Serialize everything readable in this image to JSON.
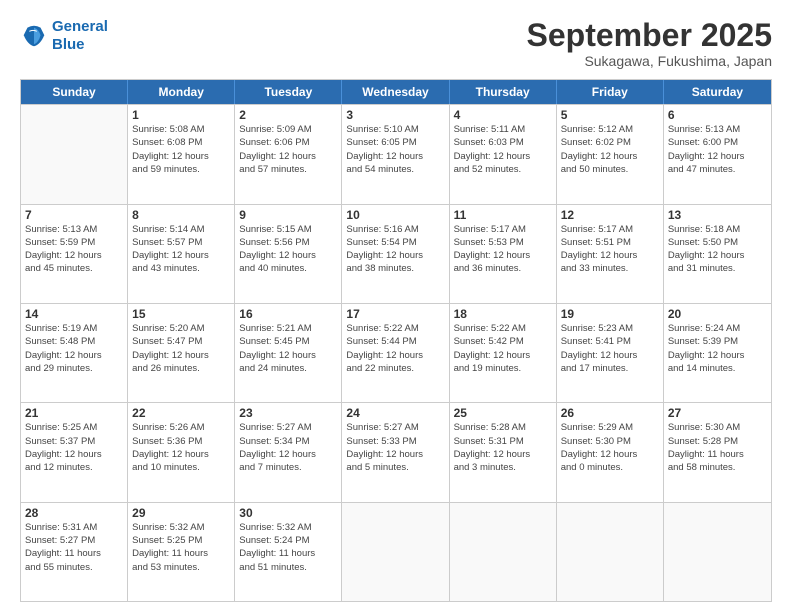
{
  "logo": {
    "line1": "General",
    "line2": "Blue"
  },
  "title": "September 2025",
  "subtitle": "Sukagawa, Fukushima, Japan",
  "header_days": [
    "Sunday",
    "Monday",
    "Tuesday",
    "Wednesday",
    "Thursday",
    "Friday",
    "Saturday"
  ],
  "weeks": [
    [
      {
        "day": "",
        "info": ""
      },
      {
        "day": "1",
        "info": "Sunrise: 5:08 AM\nSunset: 6:08 PM\nDaylight: 12 hours\nand 59 minutes."
      },
      {
        "day": "2",
        "info": "Sunrise: 5:09 AM\nSunset: 6:06 PM\nDaylight: 12 hours\nand 57 minutes."
      },
      {
        "day": "3",
        "info": "Sunrise: 5:10 AM\nSunset: 6:05 PM\nDaylight: 12 hours\nand 54 minutes."
      },
      {
        "day": "4",
        "info": "Sunrise: 5:11 AM\nSunset: 6:03 PM\nDaylight: 12 hours\nand 52 minutes."
      },
      {
        "day": "5",
        "info": "Sunrise: 5:12 AM\nSunset: 6:02 PM\nDaylight: 12 hours\nand 50 minutes."
      },
      {
        "day": "6",
        "info": "Sunrise: 5:13 AM\nSunset: 6:00 PM\nDaylight: 12 hours\nand 47 minutes."
      }
    ],
    [
      {
        "day": "7",
        "info": "Sunrise: 5:13 AM\nSunset: 5:59 PM\nDaylight: 12 hours\nand 45 minutes."
      },
      {
        "day": "8",
        "info": "Sunrise: 5:14 AM\nSunset: 5:57 PM\nDaylight: 12 hours\nand 43 minutes."
      },
      {
        "day": "9",
        "info": "Sunrise: 5:15 AM\nSunset: 5:56 PM\nDaylight: 12 hours\nand 40 minutes."
      },
      {
        "day": "10",
        "info": "Sunrise: 5:16 AM\nSunset: 5:54 PM\nDaylight: 12 hours\nand 38 minutes."
      },
      {
        "day": "11",
        "info": "Sunrise: 5:17 AM\nSunset: 5:53 PM\nDaylight: 12 hours\nand 36 minutes."
      },
      {
        "day": "12",
        "info": "Sunrise: 5:17 AM\nSunset: 5:51 PM\nDaylight: 12 hours\nand 33 minutes."
      },
      {
        "day": "13",
        "info": "Sunrise: 5:18 AM\nSunset: 5:50 PM\nDaylight: 12 hours\nand 31 minutes."
      }
    ],
    [
      {
        "day": "14",
        "info": "Sunrise: 5:19 AM\nSunset: 5:48 PM\nDaylight: 12 hours\nand 29 minutes."
      },
      {
        "day": "15",
        "info": "Sunrise: 5:20 AM\nSunset: 5:47 PM\nDaylight: 12 hours\nand 26 minutes."
      },
      {
        "day": "16",
        "info": "Sunrise: 5:21 AM\nSunset: 5:45 PM\nDaylight: 12 hours\nand 24 minutes."
      },
      {
        "day": "17",
        "info": "Sunrise: 5:22 AM\nSunset: 5:44 PM\nDaylight: 12 hours\nand 22 minutes."
      },
      {
        "day": "18",
        "info": "Sunrise: 5:22 AM\nSunset: 5:42 PM\nDaylight: 12 hours\nand 19 minutes."
      },
      {
        "day": "19",
        "info": "Sunrise: 5:23 AM\nSunset: 5:41 PM\nDaylight: 12 hours\nand 17 minutes."
      },
      {
        "day": "20",
        "info": "Sunrise: 5:24 AM\nSunset: 5:39 PM\nDaylight: 12 hours\nand 14 minutes."
      }
    ],
    [
      {
        "day": "21",
        "info": "Sunrise: 5:25 AM\nSunset: 5:37 PM\nDaylight: 12 hours\nand 12 minutes."
      },
      {
        "day": "22",
        "info": "Sunrise: 5:26 AM\nSunset: 5:36 PM\nDaylight: 12 hours\nand 10 minutes."
      },
      {
        "day": "23",
        "info": "Sunrise: 5:27 AM\nSunset: 5:34 PM\nDaylight: 12 hours\nand 7 minutes."
      },
      {
        "day": "24",
        "info": "Sunrise: 5:27 AM\nSunset: 5:33 PM\nDaylight: 12 hours\nand 5 minutes."
      },
      {
        "day": "25",
        "info": "Sunrise: 5:28 AM\nSunset: 5:31 PM\nDaylight: 12 hours\nand 3 minutes."
      },
      {
        "day": "26",
        "info": "Sunrise: 5:29 AM\nSunset: 5:30 PM\nDaylight: 12 hours\nand 0 minutes."
      },
      {
        "day": "27",
        "info": "Sunrise: 5:30 AM\nSunset: 5:28 PM\nDaylight: 11 hours\nand 58 minutes."
      }
    ],
    [
      {
        "day": "28",
        "info": "Sunrise: 5:31 AM\nSunset: 5:27 PM\nDaylight: 11 hours\nand 55 minutes."
      },
      {
        "day": "29",
        "info": "Sunrise: 5:32 AM\nSunset: 5:25 PM\nDaylight: 11 hours\nand 53 minutes."
      },
      {
        "day": "30",
        "info": "Sunrise: 5:32 AM\nSunset: 5:24 PM\nDaylight: 11 hours\nand 51 minutes."
      },
      {
        "day": "",
        "info": ""
      },
      {
        "day": "",
        "info": ""
      },
      {
        "day": "",
        "info": ""
      },
      {
        "day": "",
        "info": ""
      }
    ]
  ]
}
